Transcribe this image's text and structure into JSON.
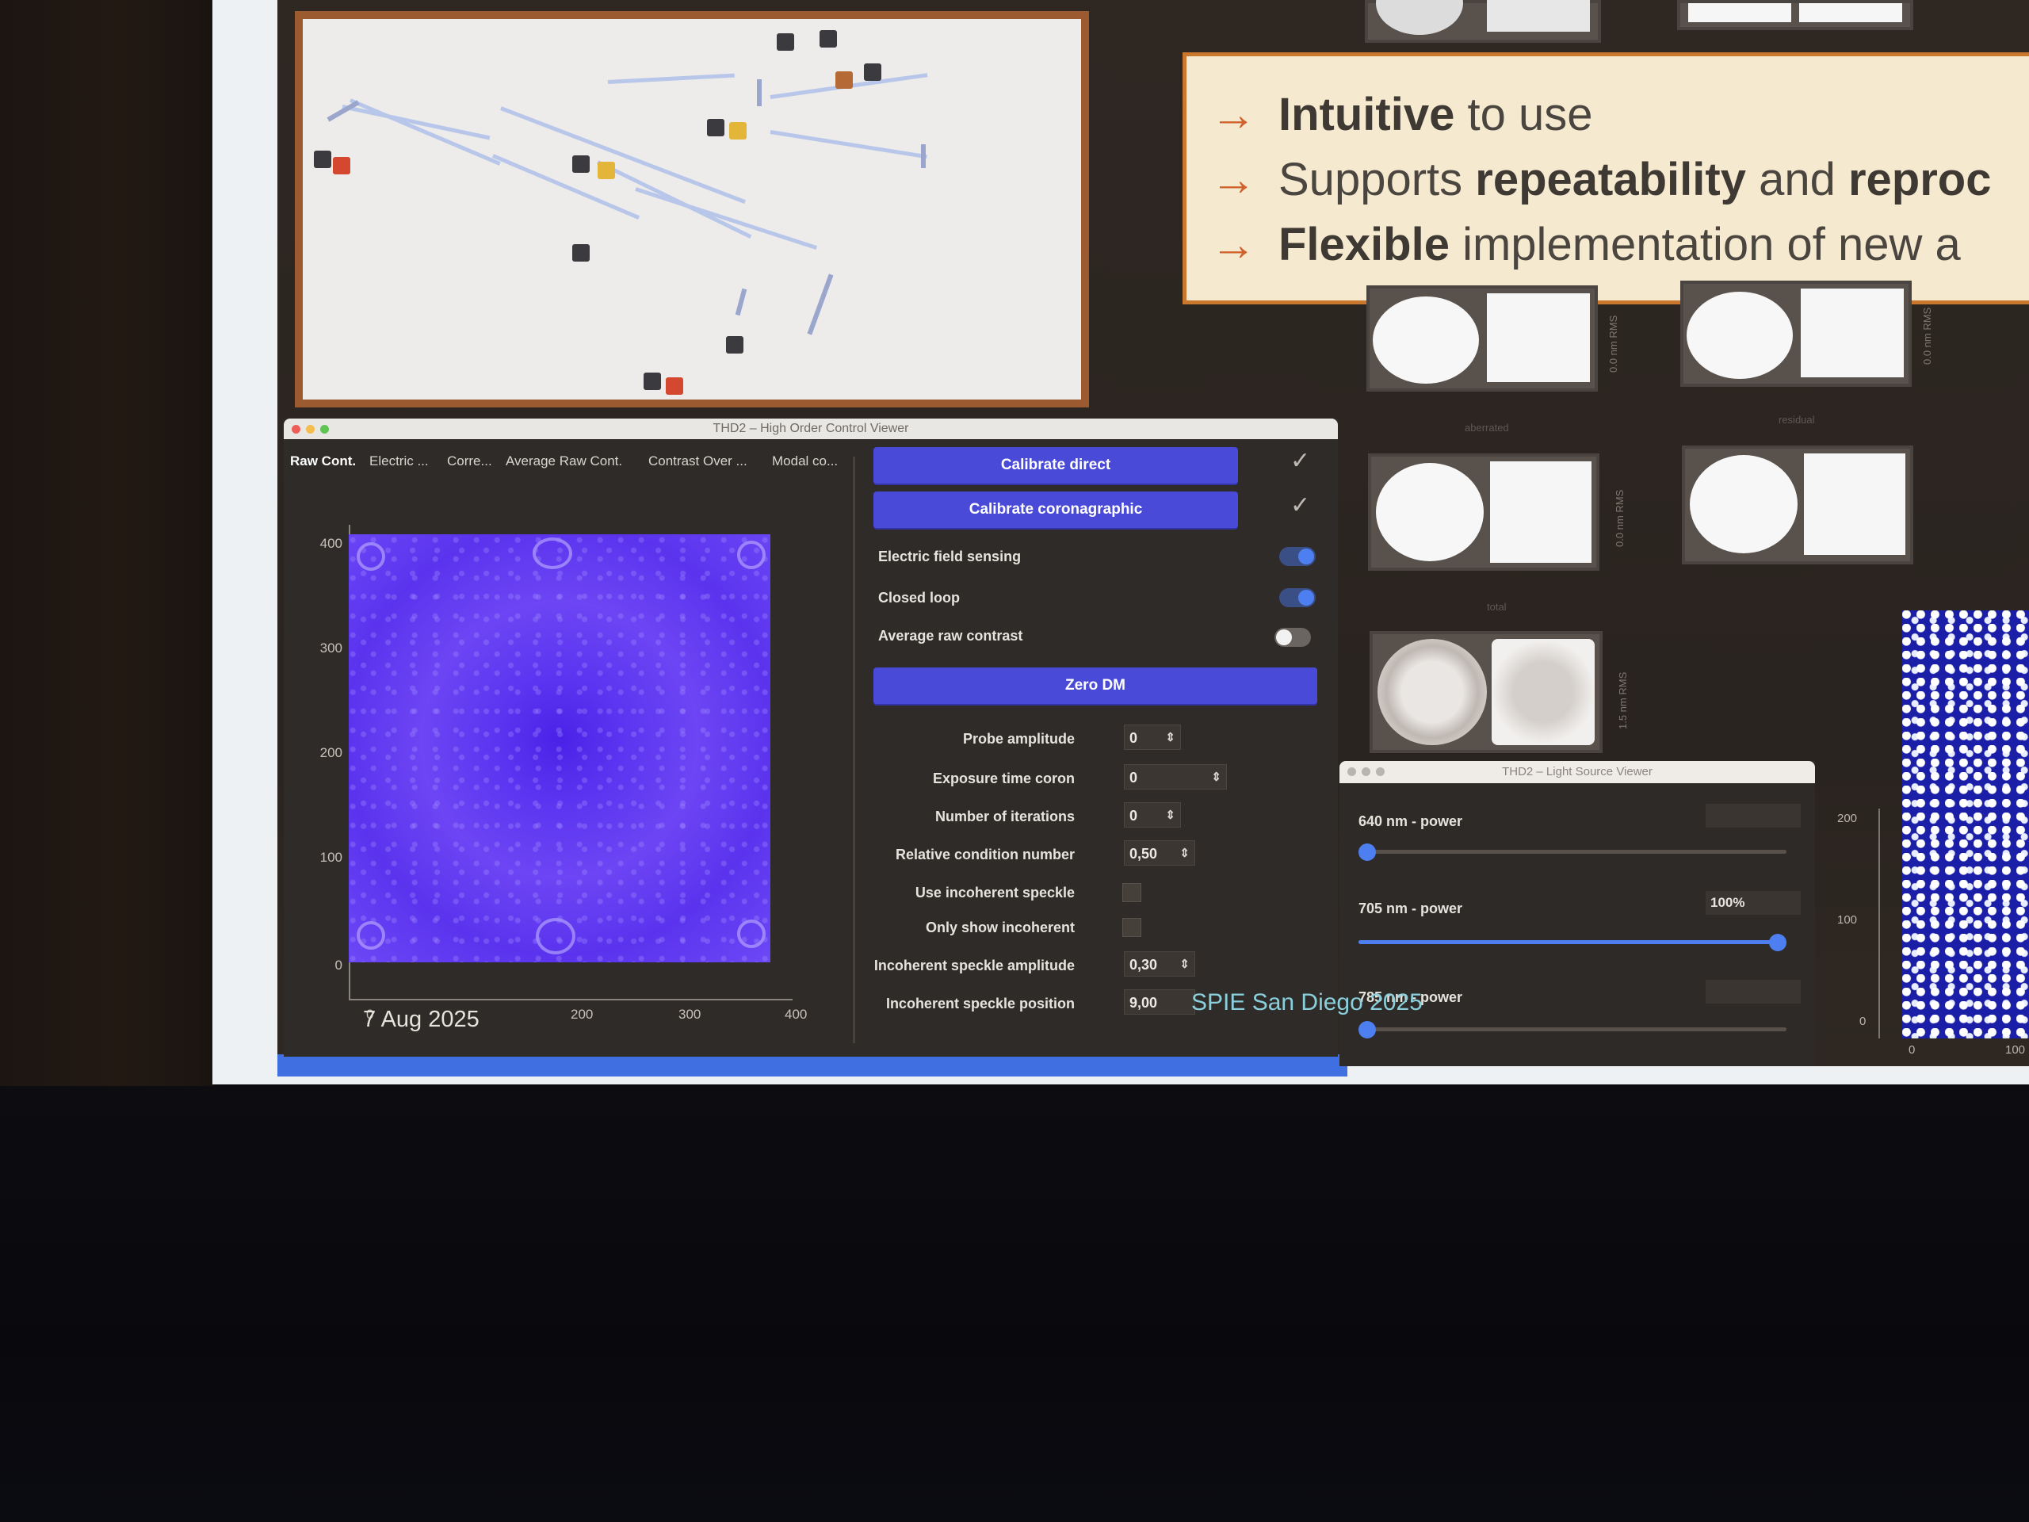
{
  "slide": {
    "bullets": [
      {
        "arrow": "→",
        "bold": "Intuitive",
        "rest": " to use"
      },
      {
        "arrow": "→",
        "pre": "Supports ",
        "bold": "repeatability",
        "mid": " and ",
        "bold2": "reproc"
      },
      {
        "arrow": "→",
        "bold": "Flexible",
        "rest": " implementation of new a"
      }
    ],
    "date": "7 Aug 2025",
    "watermark": "SPIE San Diego 2025"
  },
  "viewer": {
    "title": "THD2 – High Order Control Viewer",
    "tabs": [
      "Raw Cont.",
      "Electric ...",
      "Corre...",
      "Average Raw Cont.",
      "Contrast Over ...",
      "Modal co..."
    ],
    "plot": {
      "y_ticks": [
        "400",
        "300",
        "200",
        "100",
        "0"
      ],
      "x_ticks": [
        "0",
        "200",
        "300",
        "400"
      ]
    },
    "buttons": {
      "calibrate_direct": "Calibrate direct",
      "calibrate_coronagraphic": "Calibrate coronagraphic",
      "zero_dm": "Zero DM"
    },
    "check_mark": "✓",
    "toggles": [
      {
        "label": "Electric field sensing",
        "on": true
      },
      {
        "label": "Closed loop",
        "on": true
      },
      {
        "label": "Average raw contrast",
        "on": false
      }
    ],
    "params": [
      {
        "label": "Probe amplitude",
        "value": "0"
      },
      {
        "label": "Exposure time coron",
        "value": "0"
      },
      {
        "label": "Number of iterations",
        "value": "0"
      },
      {
        "label": "Relative condition number",
        "value": "0,50"
      }
    ],
    "checkboxes": [
      {
        "label": "Use incoherent speckle"
      },
      {
        "label": "Only show incoherent"
      }
    ],
    "incoherent": [
      {
        "label": "Incoherent speckle amplitude",
        "value": "0,30"
      },
      {
        "label": "Incoherent speckle position",
        "value": "9,00"
      }
    ],
    "spin_arrows": "⇕"
  },
  "light_source": {
    "title": "THD2 – Light Source Viewer",
    "channels": [
      {
        "label": "640 nm - power",
        "value": "",
        "level": 0.0
      },
      {
        "label": "705 nm - power",
        "value": "100%",
        "level": 1.0
      },
      {
        "label": "785 nm - power",
        "value": "",
        "level": 0.0
      }
    ]
  },
  "right_plot": {
    "y_ticks": [
      "200",
      "100",
      "0"
    ],
    "x_ticks": [
      "0",
      "100"
    ]
  },
  "thumbnails": {
    "rms_labels": [
      "0.0 nm RMS",
      "0.0 nm RMS",
      "0.0 nm RMS",
      "1.5 nm RMS"
    ],
    "section_labels": [
      "aberrated",
      "residual",
      "total"
    ]
  },
  "colors": {
    "accent": "#4a4ad8",
    "toggle_on": "#4d7ff0",
    "callout_arrow": "#d0632d",
    "frame": "#9c5a30"
  }
}
